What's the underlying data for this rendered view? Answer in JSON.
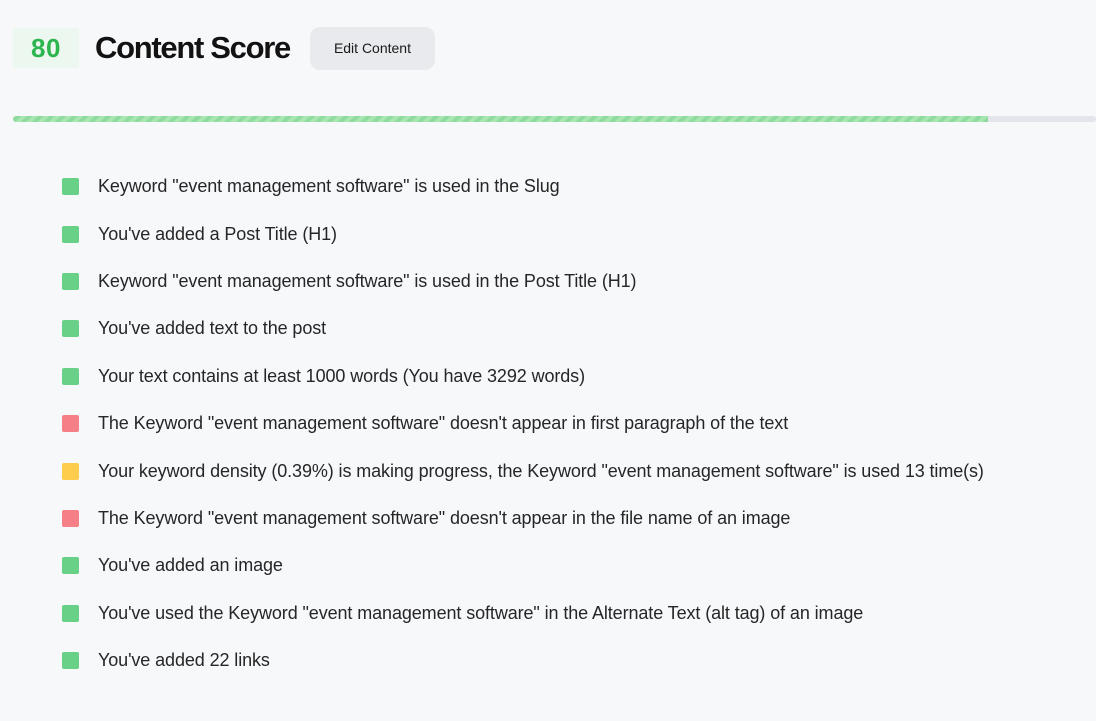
{
  "header": {
    "score": "80",
    "title": "Content Score",
    "edit_label": "Edit Content"
  },
  "progress": {
    "value_percent": 90,
    "colors": {
      "fill": "#8fdb9e",
      "track": "#e3e5ea"
    }
  },
  "status_colors": {
    "good": "#69d088",
    "bad": "#f47f86",
    "warn": "#ffcd4d"
  },
  "checks": [
    {
      "status": "good",
      "text": "Keyword \"event management software\" is used in the Slug"
    },
    {
      "status": "good",
      "text": "You've added a Post Title (H1)"
    },
    {
      "status": "good",
      "text": "Keyword \"event management software\" is used in the Post Title (H1)"
    },
    {
      "status": "good",
      "text": "You've added text to the post"
    },
    {
      "status": "good",
      "text": "Your text contains at least 1000 words (You have 3292 words)"
    },
    {
      "status": "bad",
      "text": "The Keyword \"event management software\" doesn't appear in first paragraph of the text"
    },
    {
      "status": "warn",
      "text": "Your keyword density (0.39%) is making progress, the Keyword \"event management software\" is used 13 time(s)"
    },
    {
      "status": "bad",
      "text": "The Keyword \"event management software\" doesn't appear in the file name of an image"
    },
    {
      "status": "good",
      "text": "You've added an image"
    },
    {
      "status": "good",
      "text": "You've used the Keyword \"event management software\" in the Alternate Text (alt tag) of an image"
    },
    {
      "status": "good",
      "text": "You've added 22 links"
    }
  ]
}
